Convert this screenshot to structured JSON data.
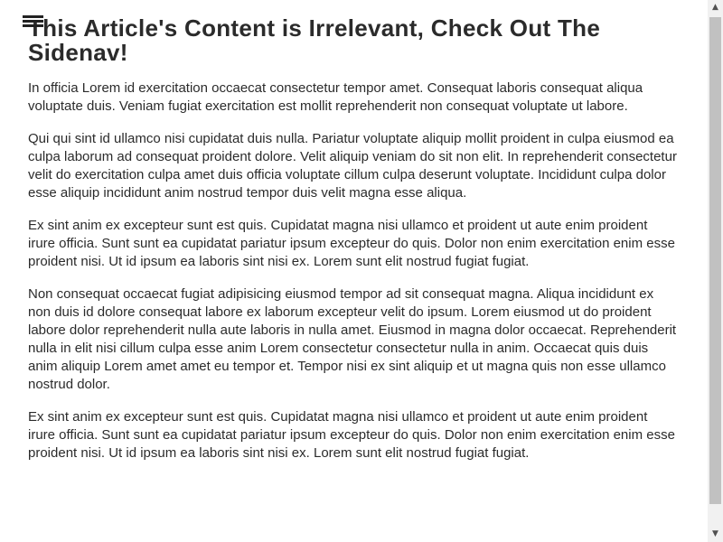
{
  "article": {
    "title": "This Article's Content is Irrelevant, Check Out The Sidenav!",
    "paragraphs": [
      "In officia Lorem id exercitation occaecat consectetur tempor amet. Consequat laboris consequat aliqua voluptate duis. Veniam fugiat exercitation est mollit reprehenderit non consequat voluptate ut labore.",
      "Qui qui sint id ullamco nisi cupidatat duis nulla. Pariatur voluptate aliquip mollit proident in culpa eiusmod ea culpa laborum ad consequat proident dolore. Velit aliquip veniam do sit non elit. In reprehenderit consectetur velit do exercitation culpa amet duis officia voluptate cillum culpa deserunt voluptate. Incididunt culpa dolor esse aliquip incididunt anim nostrud tempor duis velit magna esse aliqua.",
      "Ex sint anim ex excepteur sunt est quis. Cupidatat magna nisi ullamco et proident ut aute enim proident irure officia. Sunt sunt ea cupidatat pariatur ipsum excepteur do quis. Dolor non enim exercitation enim esse proident nisi. Ut id ipsum ea laboris sint nisi ex. Lorem sunt elit nostrud fugiat fugiat.",
      "Non consequat occaecat fugiat adipisicing eiusmod tempor ad sit consequat magna. Aliqua incididunt ex non duis id dolore consequat labore ex laborum excepteur velit do ipsum. Lorem eiusmod ut do proident labore dolor reprehenderit nulla aute laboris in nulla amet. Eiusmod in magna dolor occaecat. Reprehenderit nulla in elit nisi cillum culpa esse anim Lorem consectetur consectetur nulla in anim. Occaecat quis duis anim aliquip Lorem amet amet eu tempor et. Tempor nisi ex sint aliquip et ut magna quis non esse ullamco nostrud dolor.",
      "Ex sint anim ex excepteur sunt est quis. Cupidatat magna nisi ullamco et proident ut aute enim proident irure officia. Sunt sunt ea cupidatat pariatur ipsum excepteur do quis. Dolor non enim exercitation enim esse proident nisi. Ut id ipsum ea laboris sint nisi ex. Lorem sunt elit nostrud fugiat fugiat."
    ]
  },
  "menu": {
    "icon": "hamburger-menu-icon"
  },
  "scrollbar": {
    "up_arrow": "▲",
    "down_arrow": "▼"
  }
}
